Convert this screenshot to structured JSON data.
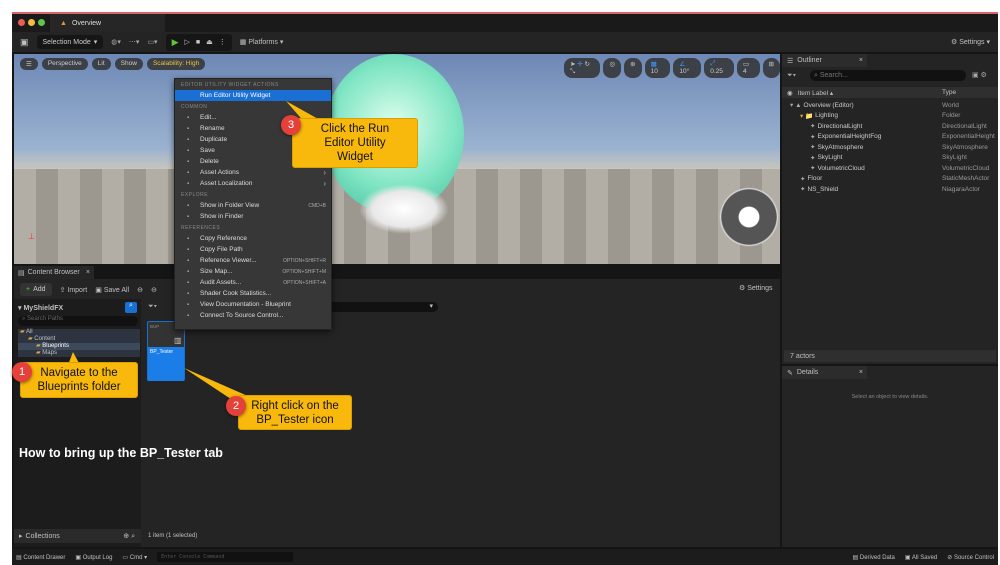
{
  "window": {
    "title": "Overview"
  },
  "toolbar": {
    "mode": "Selection Mode",
    "platforms": "Platforms",
    "settings": "Settings"
  },
  "viewport": {
    "perspective": "Perspective",
    "lit": "Lit",
    "show": "Show",
    "scalability": "Scalability: High",
    "grid": "10",
    "angle": "10°",
    "scale": "0.25",
    "camera": "4"
  },
  "context_menu": {
    "sections": [
      {
        "title": "EDITOR UTILITY WIDGET ACTIONS",
        "items": [
          {
            "label": "Run Editor Utility Widget",
            "icon": "widget-icon",
            "highlighted": true
          }
        ]
      },
      {
        "title": "COMMON",
        "items": [
          {
            "label": "Edit...",
            "icon": "pencil-icon"
          },
          {
            "label": "Rename",
            "icon": "rename-icon"
          },
          {
            "label": "Duplicate",
            "icon": "duplicate-icon"
          },
          {
            "label": "Save",
            "icon": "save-icon"
          },
          {
            "label": "Delete",
            "icon": "trash-icon"
          },
          {
            "label": "Asset Actions",
            "icon": "wrench-icon",
            "submenu": true
          },
          {
            "label": "Asset Localization",
            "icon": "flag-icon",
            "submenu": true
          }
        ]
      },
      {
        "title": "EXPLORE",
        "items": [
          {
            "label": "Show in Folder View",
            "icon": "folder-icon",
            "shortcut": "CMD+B"
          },
          {
            "label": "Show in Finder",
            "icon": "finder-icon"
          }
        ]
      },
      {
        "title": "REFERENCES",
        "items": [
          {
            "label": "Copy Reference",
            "icon": "copy-icon"
          },
          {
            "label": "Copy File Path",
            "icon": "copy-icon"
          },
          {
            "label": "Reference Viewer...",
            "icon": "graph-icon",
            "shortcut": "OPTION+SHIFT+R"
          },
          {
            "label": "Size Map...",
            "icon": "sizemap-icon",
            "shortcut": "OPTION+SHIFT+M"
          },
          {
            "label": "Audit Assets...",
            "icon": "audit-icon",
            "shortcut": "OPTION+SHIFT+A"
          },
          {
            "label": "Shader Cook Statistics...",
            "icon": "shader-icon"
          },
          {
            "label": "View Documentation - Blueprint",
            "icon": "book-icon"
          },
          {
            "label": "Connect To Source Control...",
            "icon": "source-control-icon"
          }
        ]
      }
    ]
  },
  "outliner": {
    "tab": "Outliner",
    "search_placeholder": "Search...",
    "col_label": "Item Label ▴",
    "col_type": "Type",
    "count": "7 actors",
    "rows": [
      {
        "label": "Overview (Editor)",
        "type": "World",
        "indent": 0
      },
      {
        "label": "Lighting",
        "type": "Folder",
        "indent": 1
      },
      {
        "label": "DirectionalLight",
        "type": "DirectionalLight",
        "indent": 2
      },
      {
        "label": "ExponentialHeightFog",
        "type": "ExponentialHeight",
        "indent": 2
      },
      {
        "label": "SkyAtmosphere",
        "type": "SkyAtmosphere",
        "indent": 2
      },
      {
        "label": "SkyLight",
        "type": "SkyLight",
        "indent": 2
      },
      {
        "label": "VolumetricCloud",
        "type": "VolumetricCloud",
        "indent": 2
      },
      {
        "label": "Floor",
        "type": "StaticMeshActor",
        "indent": 1
      },
      {
        "label": "NS_Shield",
        "type": "NiagaraActor",
        "indent": 1
      }
    ]
  },
  "details": {
    "tab": "Details",
    "empty": "Select an object to view details."
  },
  "content_browser": {
    "tab": "Content Browser",
    "add": "Add",
    "import": "Import",
    "save_all": "Save All",
    "settings": "Settings",
    "project": "MyShieldFX",
    "search_paths_placeholder": "Search Paths",
    "tree": [
      {
        "label": "All",
        "indent": 0
      },
      {
        "label": "Content",
        "indent": 1
      },
      {
        "label": "Blueprints",
        "indent": 2,
        "selected": true
      },
      {
        "label": "Maps",
        "indent": 2
      }
    ],
    "asset": {
      "type": "BUP",
      "name": "BP_Tester"
    },
    "status": "1 item (1 selected)",
    "collections": "Collections"
  },
  "statusbar": {
    "content_drawer": "Content Drawer",
    "output_log": "Output Log",
    "cmd": "Cmd",
    "console_placeholder": "Enter Console Command",
    "derived_data": "Derived Data",
    "all_saved": "All Saved",
    "source_control": "Source Control"
  },
  "annotations": {
    "step1_num": "1",
    "step1": "Navigate to the Blueprints folder",
    "step2_num": "2",
    "step2": "Right click on the BP_Tester icon",
    "step3_num": "3",
    "step3": "Click the Run Editor Utility Widget",
    "caption": "How to bring up the BP_Tester tab"
  }
}
